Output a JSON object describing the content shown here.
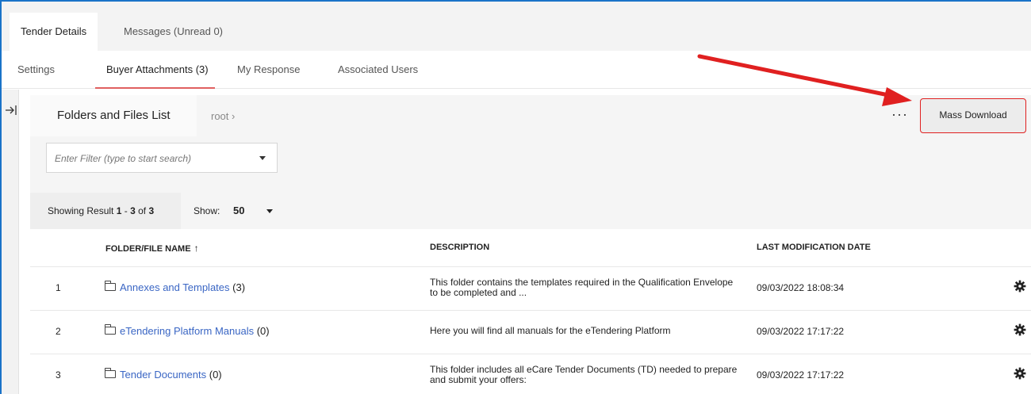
{
  "top_tabs": [
    {
      "label": "Tender Details"
    },
    {
      "label": "Messages (Unread 0)"
    }
  ],
  "sub_tabs": [
    {
      "label": "Settings"
    },
    {
      "label": "Buyer Attachments (3)"
    },
    {
      "label": "My Response"
    },
    {
      "label": "Associated Users"
    }
  ],
  "left_rail": {
    "icon": "collapse-right-icon",
    "glyph": "→|"
  },
  "folder_header": {
    "title": "Folders and Files List",
    "breadcrumb": "root ›",
    "more": "···",
    "mass_download": "Mass Download"
  },
  "filter": {
    "placeholder": "Enter Filter (type to start search)"
  },
  "results": {
    "prefix": "Showing Result ",
    "from": "1",
    "dash": " - ",
    "to": "3",
    "of": " of ",
    "total": "3",
    "show_label": "Show:",
    "show_value": "50"
  },
  "table": {
    "headers": {
      "name": "FOLDER/FILE NAME",
      "sort_icon": "↑",
      "description": "DESCRIPTION",
      "date": "LAST MODIFICATION DATE"
    },
    "rows": [
      {
        "num": "1",
        "name": "Annexes and Templates",
        "count": " (3)",
        "description": "This folder contains the templates required in the Qualification Envelope to be completed and ...",
        "date": "09/03/2022 18:08:34"
      },
      {
        "num": "2",
        "name": "eTendering Platform Manuals",
        "count": " (0)",
        "description": "Here you will find all manuals for the eTendering Platform",
        "date": "09/03/2022 17:17:22"
      },
      {
        "num": "3",
        "name": "Tender Documents",
        "count": " (0)",
        "description": "This folder includes all eCare Tender Documents (TD) needed to prepare and submit your offers:",
        "date": "09/03/2022 17:17:22"
      }
    ]
  },
  "colors": {
    "accent_link": "#3a66c4",
    "annotation_red": "#e02020",
    "tab_underline": "#e06060",
    "frame_blue": "#1a73c8"
  }
}
